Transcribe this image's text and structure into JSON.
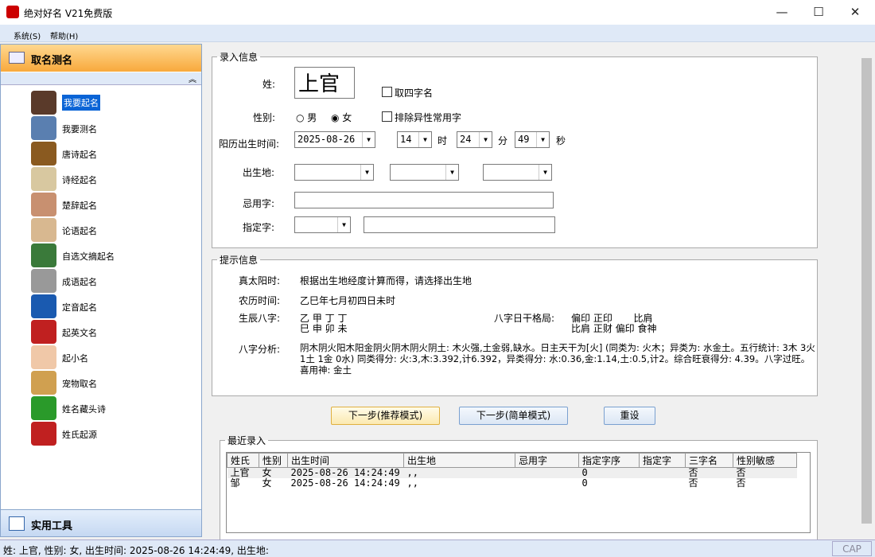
{
  "window": {
    "title": "绝对好名 V21免费版",
    "min": "—",
    "max": "☐",
    "close": "✕"
  },
  "menu": [
    "系统(S)",
    "帮助(H)"
  ],
  "sidebar": {
    "header": "取名测名",
    "footer": "实用工具",
    "items": [
      {
        "label": "我要起名",
        "color": "#5a3a2a"
      },
      {
        "label": "我要测名",
        "color": "#5a7fb0"
      },
      {
        "label": "唐诗起名",
        "color": "#8a5a20"
      },
      {
        "label": "诗经起名",
        "color": "#d8c8a0"
      },
      {
        "label": "楚辞起名",
        "color": "#c89070"
      },
      {
        "label": "论语起名",
        "color": "#d8b890"
      },
      {
        "label": "自选文摘起名",
        "color": "#3a7a3a"
      },
      {
        "label": "成语起名",
        "color": "#999999"
      },
      {
        "label": "定音起名",
        "color": "#1a5ab0"
      },
      {
        "label": "起英文名",
        "color": "#c02020"
      },
      {
        "label": "起小名",
        "color": "#f0c8a8"
      },
      {
        "label": "宠物取名",
        "color": "#d0a050"
      },
      {
        "label": "姓名藏头诗",
        "color": "#2a9a2a"
      },
      {
        "label": "姓氏起源",
        "color": "#c02020"
      }
    ]
  },
  "input": {
    "legend": "录入信息",
    "surname_label": "姓:",
    "surname": "上官",
    "four_char": "取四字名",
    "gender_label": "性别:",
    "male": "男",
    "female": "女",
    "exclude": "排除异性常用字",
    "birth_label": "阳历出生时间:",
    "date": "2025-08-26",
    "hour": "14",
    "hour_unit": "时",
    "minute": "24",
    "minute_unit": "分",
    "second": "49",
    "second_unit": "秒",
    "place_label": "出生地:",
    "avoid_label": "忌用字:",
    "assign_label": "指定字:"
  },
  "hint": {
    "legend": "提示信息",
    "solar_label": "真太阳时:",
    "solar": "根据出生地经度计算而得，请选择出生地",
    "lunar_label": "农历时间:",
    "lunar": "乙巳年七月初四日未时",
    "bazi_label": "生辰八字:",
    "bazi1": "乙 甲 丁 丁",
    "bazi2": "巳 申 卯 未",
    "geju_label": "八字日干格局:",
    "geju1": "偏印 正印       比肩",
    "geju2": "比肩 正财 偏印 食神",
    "analysis_label": "八字分析:",
    "analysis": "阴木阴火阳木阳金阴火阴木阴火阴土: 木火强,土金弱,缺水。日主天干为[火] (同类为: 火木；异类为: 水金土。五行统计: 3木 3火 1土 1金 0水) 同类得分: 火:3,木:3.392,计6.392，异类得分: 水:0.36,金:1.14,土:0.5,计2。综合旺衰得分: 4.39。八字过旺。喜用神: 金土"
  },
  "buttons": {
    "next_recommend": "下一步(推荐模式)",
    "next_simple": "下一步(简单模式)",
    "reset": "重设"
  },
  "recent": {
    "legend": "最近录入",
    "columns": [
      "姓氏",
      "性别",
      "出生时间",
      "出生地",
      "忌用字",
      "指定字序",
      "指定字",
      "三字名",
      "性别敏感"
    ],
    "rows": [
      [
        "上官",
        "女",
        "2025-08-26 14:24:49",
        ",,",
        "",
        "0",
        "",
        "否",
        "否"
      ],
      [
        "邹",
        "女",
        "2025-08-26 14:24:49",
        ",,",
        "",
        "0",
        "",
        "否",
        "否"
      ]
    ]
  },
  "status": {
    "text": "姓: 上官, 性别: 女, 出生时间: 2025-08-26 14:24:49, 出生地:",
    "cap": "CAP"
  }
}
